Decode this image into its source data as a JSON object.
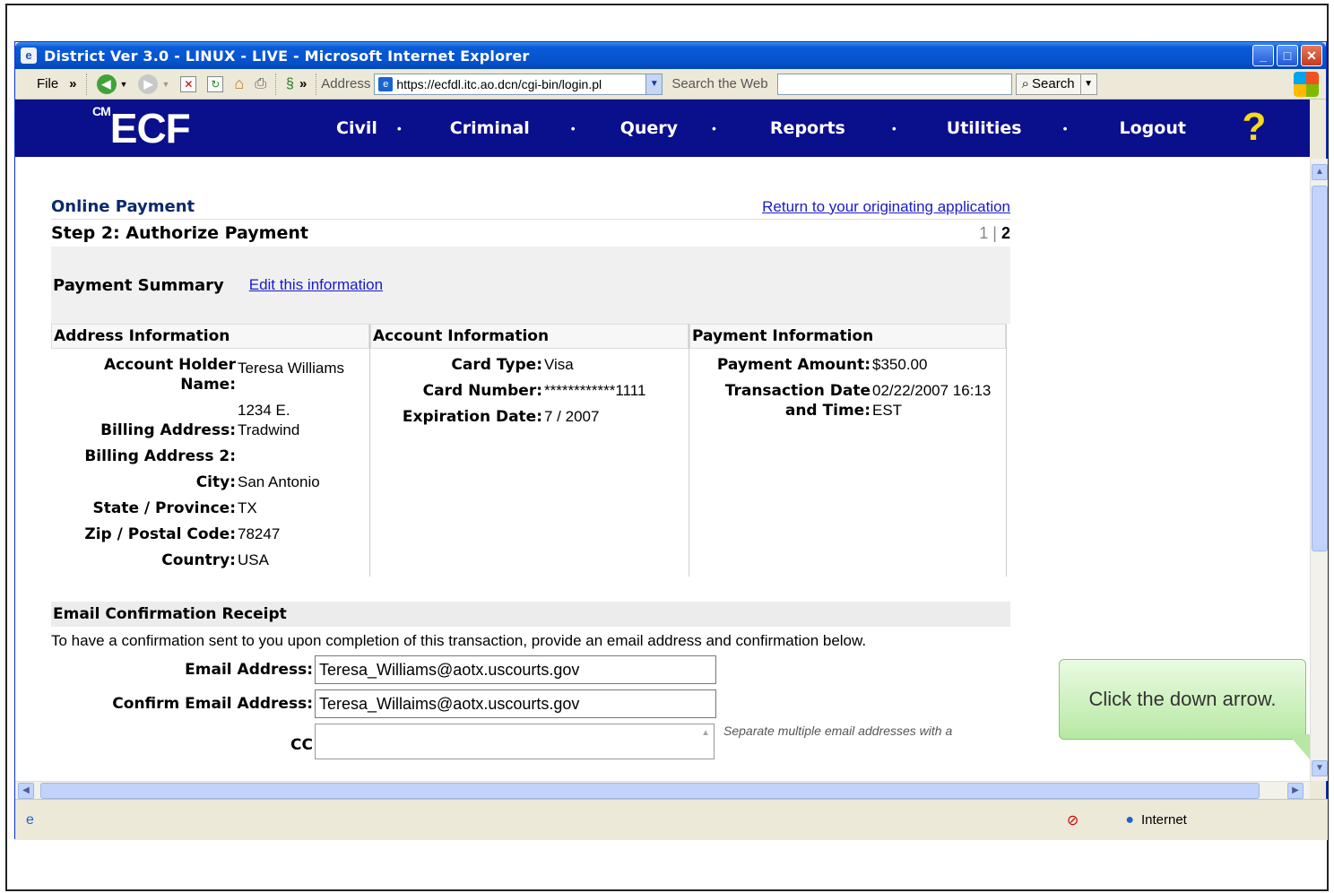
{
  "window": {
    "title": "District Ver 3.0 - LINUX - LIVE - Microsoft Internet Explorer",
    "minimize": "_",
    "maximize": "□",
    "close": "✕"
  },
  "toolbar": {
    "file": "File",
    "chevron": "»",
    "address_label": "Address",
    "url": "https://ecfdl.itc.ao.dcn/cgi-bin/login.pl",
    "search_web_label": "Search the Web",
    "search_button": "Search"
  },
  "nav": {
    "logo_prefix": "CM",
    "logo": "ECF",
    "items": [
      "Civil",
      "Criminal",
      "Query",
      "Reports",
      "Utilities",
      "Logout"
    ],
    "dot": "•"
  },
  "payment": {
    "title": "Online Payment",
    "return_link": "Return to your originating application",
    "step": "Step 2: Authorize Payment",
    "pager_1": "1",
    "pager_sep": "|",
    "pager_2": "2",
    "summary_label": "Payment Summary",
    "edit_link": "Edit this information",
    "address_header": "Address Information",
    "account_header": "Account Information",
    "payinfo_header": "Payment Information",
    "address": {
      "holder_label": "Account Holder Name:",
      "holder": "Teresa Williams",
      "billing_label": "Billing Address:",
      "billing": "1234 E. Tradwind",
      "billing2_label": "Billing Address 2:",
      "billing2": "",
      "city_label": "City:",
      "city": "San Antonio",
      "state_label": "State / Province:",
      "state": "TX",
      "zip_label": "Zip / Postal Code:",
      "zip": "78247",
      "country_label": "Country:",
      "country": "USA"
    },
    "account": {
      "card_type_label": "Card Type:",
      "card_type": "Visa",
      "card_number_label": "Card Number:",
      "card_number": "************1111",
      "expiration_label": "Expiration Date:",
      "expiration": "7 / 2007"
    },
    "payinfo": {
      "amount_label": "Payment Amount:",
      "amount": "$350.00",
      "date_label": "Transaction Date and Time:",
      "date": "02/22/2007 16:13 EST"
    },
    "email_header": "Email Confirmation Receipt",
    "email_instructions": "To have a confirmation sent to you upon completion of this transaction, provide an email address and confirmation below.",
    "email_label": "Email Address:",
    "email_value": "Teresa_Williams@aotx.uscourts.gov",
    "confirm_label": "Confirm Email Address:",
    "confirm_value": "Teresa_Willaims@aotx.uscourts.gov",
    "cc_label": "CC",
    "cc_hint": "Separate multiple email addresses with a"
  },
  "status": {
    "zone": "Internet"
  },
  "callout": {
    "text": "Click the down arrow."
  }
}
